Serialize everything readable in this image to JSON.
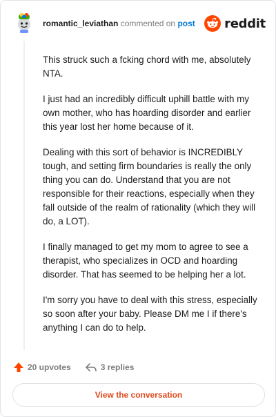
{
  "comment": {
    "username": "romantic_leviathan",
    "commented_on": "commented on",
    "post_link": "post",
    "paragraphs": [
      "This struck such a fcking chord with me, absolutely NTA.",
      "I just had an incredibly difficult uphill battle with my own mother, who has hoarding disorder and earlier this year lost her home because of it.",
      "Dealing with this sort of behavior is INCREDIBLY tough, and setting firm boundaries is really the only thing you can do. Understand that you are not responsible for their reactions, especially when they fall outside of the realm of rationality (which they will do, a LOT).",
      "I finally managed to get my mom to agree to see a therapist, who specializes in OCD and hoarding disorder. That has seemed to be helping her a lot.",
      "I'm sorry you have to deal with this stress, especially so soon after your baby. Please DM me I if there's anything I can do to help."
    ]
  },
  "brand": {
    "wordmark": "reddit",
    "color": "#ff4500"
  },
  "actions": {
    "upvotes": "20 upvotes",
    "replies": "3 replies"
  },
  "view_button": "View the conversation",
  "icons": {
    "avatar": "snoo-avatar-icon",
    "logo": "reddit-logo-icon",
    "upvote": "upvote-arrow-icon",
    "reply": "reply-arrow-icon"
  },
  "colors": {
    "link": "#0079d3",
    "accent": "#e0481b",
    "upvote": "#ff4500"
  }
}
